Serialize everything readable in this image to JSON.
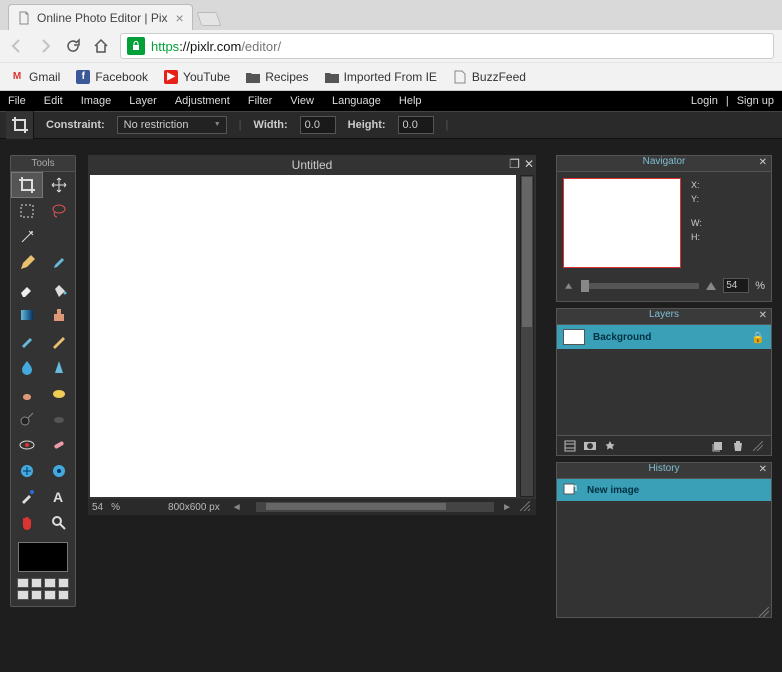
{
  "browser": {
    "tab_title": "Online Photo Editor | Pix",
    "url_https": "https",
    "url_domain": "://pixlr.com",
    "url_path": "/editor/",
    "bookmarks": [
      {
        "label": "Gmail"
      },
      {
        "label": "Facebook"
      },
      {
        "label": "YouTube"
      },
      {
        "label": "Recipes"
      },
      {
        "label": "Imported From IE"
      },
      {
        "label": "BuzzFeed"
      }
    ]
  },
  "menu": {
    "items": [
      "File",
      "Edit",
      "Image",
      "Layer",
      "Adjustment",
      "Filter",
      "View",
      "Language",
      "Help"
    ],
    "login": "Login",
    "signup": "Sign up"
  },
  "options": {
    "constraint_label": "Constraint:",
    "constraint_value": "No restriction",
    "width_label": "Width:",
    "width_value": "0.0",
    "height_label": "Height:",
    "height_value": "0.0"
  },
  "tools_title": "Tools",
  "canvas": {
    "title": "Untitled",
    "zoom": "54",
    "zoom_unit": "%",
    "dims": "800x600 px"
  },
  "navigator": {
    "title": "Navigator",
    "x": "X:",
    "y": "Y:",
    "w": "W:",
    "h": "H:",
    "zoom": "54",
    "pct": "%"
  },
  "layers": {
    "title": "Layers",
    "items": [
      {
        "name": "Background"
      }
    ]
  },
  "history": {
    "title": "History",
    "items": [
      {
        "name": "New image"
      }
    ]
  }
}
